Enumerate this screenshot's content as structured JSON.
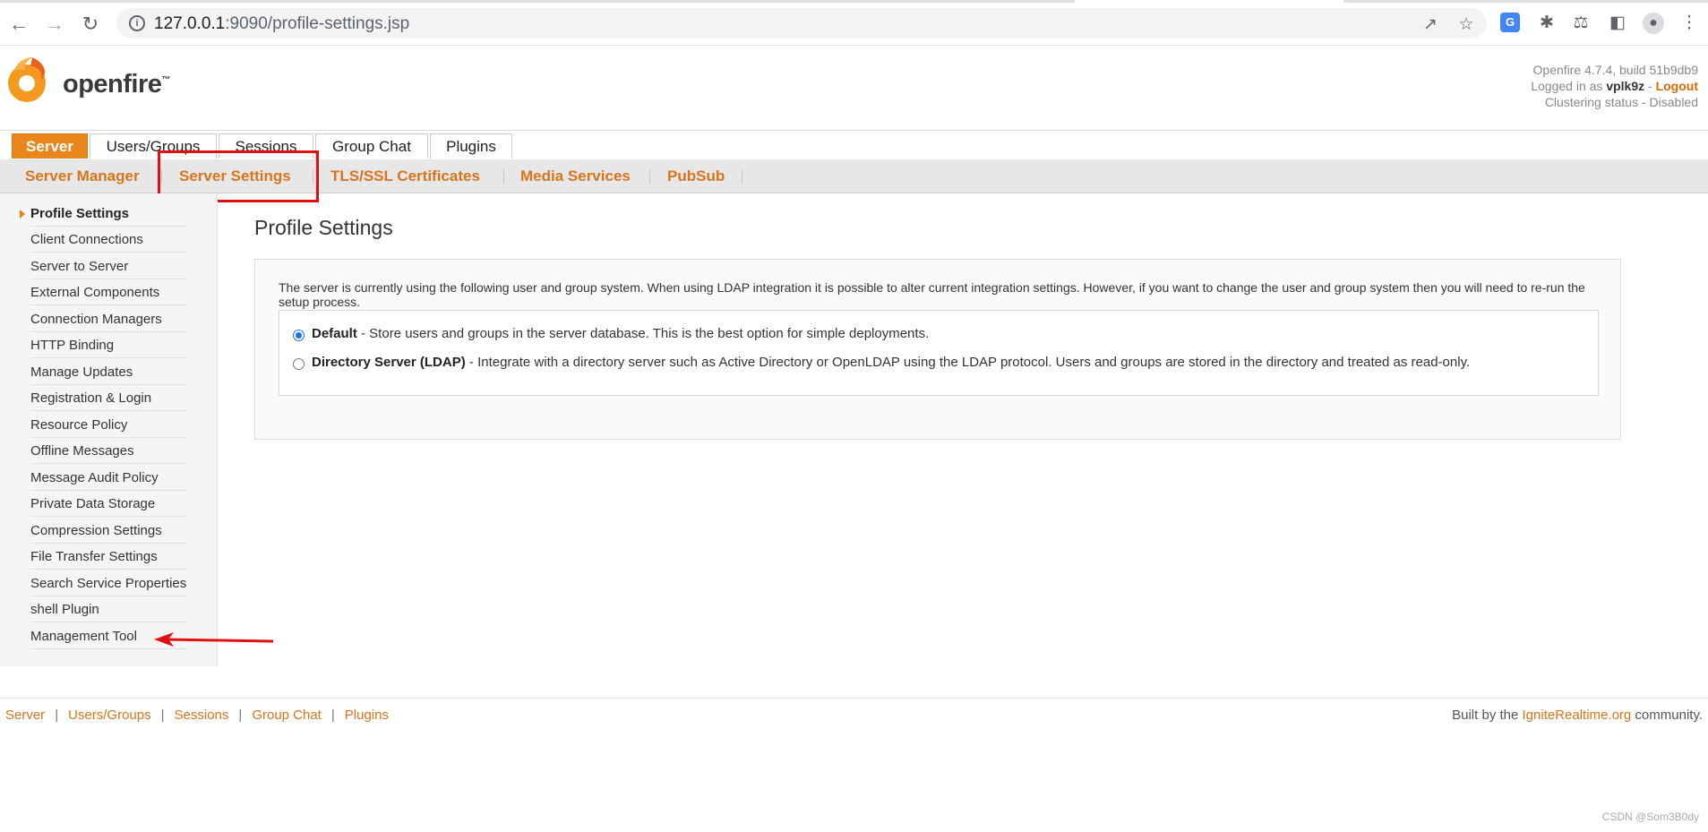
{
  "browser": {
    "url_host": "127.0.0.1",
    "url_rest": ":9090/profile-settings.jsp"
  },
  "header": {
    "logo_text": "openfire",
    "logo_tm": "™",
    "version": "Openfire 4.7.4, build 51b9db9",
    "logged_in_prefix": "Logged in as",
    "username": "vplk9z",
    "dash": "-",
    "logout": "Logout",
    "clustering": "Clustering status - Disabled"
  },
  "main_tabs": [
    "Server",
    "Users/Groups",
    "Sessions",
    "Group Chat",
    "Plugins"
  ],
  "sub_tabs": [
    "Server Manager",
    "Server Settings",
    "TLS/SSL Certificates",
    "Media Services",
    "PubSub"
  ],
  "sidebar": {
    "items": [
      "Profile Settings",
      "Client Connections",
      "Server to Server",
      "External Components",
      "Connection Managers",
      "HTTP Binding",
      "Manage Updates",
      "Registration & Login",
      "Resource Policy",
      "Offline Messages",
      "Message Audit Policy",
      "Private Data Storage",
      "Compression Settings",
      "File Transfer Settings",
      "Search Service Properties",
      "shell Plugin",
      "Management Tool"
    ]
  },
  "content": {
    "title": "Profile Settings",
    "description": "The server is currently using the following user and group system. When using LDAP integration it is possible to alter current integration settings. However, if you want to change the user and group system then you will need to re-run the setup process.",
    "options": [
      {
        "label": "Default",
        "desc": " - Store users and groups in the server database. This is the best option for simple deployments.",
        "checked": true
      },
      {
        "label": "Directory Server (LDAP)",
        "desc": " - Integrate with a directory server such as Active Directory or OpenLDAP using the LDAP protocol. Users and groups are stored in the directory and treated as read-only.",
        "checked": false
      }
    ]
  },
  "footer": {
    "links": [
      "Server",
      "Users/Groups",
      "Sessions",
      "Group Chat",
      "Plugins"
    ],
    "separator": "|",
    "built_prefix": "Built by the",
    "built_link": "IgniteRealtime.org",
    "built_suffix": "community."
  },
  "watermark": "CSDN @Som3B0dy",
  "colors": {
    "accent": "#e9861c",
    "link": "#d8741c",
    "annotation": "#e01010"
  },
  "icons": [
    "back-icon",
    "forward-icon",
    "reload-icon",
    "info-icon",
    "share-icon",
    "star-icon",
    "translate-icon",
    "extensions-icon",
    "lab-icon",
    "sidepanel-icon",
    "profile-icon",
    "menu-icon"
  ]
}
